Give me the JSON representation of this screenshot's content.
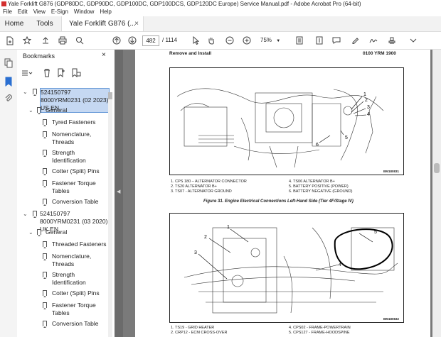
{
  "window": {
    "title": "Yale Forklift G876 (GDP80DC, GDP90DC, GDP100DC, GDP100DCS, GDP120DC Europe) Service Manual.pdf - Adobe Acrobat Pro (64-bit)"
  },
  "menu": [
    "File",
    "Edit",
    "View",
    "E-Sign",
    "Window",
    "Help"
  ],
  "tabs": {
    "home": "Home",
    "tools": "Tools",
    "doc": "Yale Forklift G876 (...",
    "close": "×"
  },
  "toolbar": {
    "page": "482",
    "total": "/ 1114",
    "zoom": "75%"
  },
  "panel": {
    "title": "Bookmarks",
    "close": "×",
    "items": [
      {
        "label": "524150797 8000YRM0231 (02 2023) US EN"
      },
      {
        "label": "General"
      },
      {
        "label": "Tyred Fasteners"
      },
      {
        "label": "Nomenclature, Threads"
      },
      {
        "label": "Strength Identification"
      },
      {
        "label": "Cotter (Split) Pins"
      },
      {
        "label": "Fastener Torque Tables"
      },
      {
        "label": "Conversion Table"
      },
      {
        "label": "524150797 8000YRM0231 (03 2020) UK EN"
      },
      {
        "label": "General"
      },
      {
        "label": "Threaded Fasteners"
      },
      {
        "label": "Nomenclature, Threads"
      },
      {
        "label": "Strength Identification"
      },
      {
        "label": "Cotter (Split) Pins"
      },
      {
        "label": "Fastener Torque Tables"
      },
      {
        "label": "Conversion Table"
      }
    ]
  },
  "page": {
    "header_left": "Remove and Install",
    "header_right": "0100 YRM 1900",
    "fig1": {
      "tag": "BM180831",
      "callouts": [
        "1",
        "2",
        "3",
        "4",
        "5",
        "6"
      ],
      "legend": [
        "1.   CPS 180 – ALTERNATOR CONNECTOR",
        "2.   TS20 ALTERNATOR B+",
        "3.   TS07 - ALTERNATOR GROUND",
        "4.   TS06 ALTERNATOR B+",
        "5.   BATTERY POSITIVE (POWER)",
        "6.   BATTERY NEGATIVE (GROUND)"
      ],
      "caption": "Figure 31. Engine Electrical Connections Left-Hand Side (Tier 4F/Stage IV)"
    },
    "fig2": {
      "tag": "BM180832",
      "callouts": [
        "1",
        "2",
        "3",
        "4",
        "5"
      ],
      "legend": [
        "1.   TS19 - GRID HEATER",
        "2.   CRP12 - ECM CROSS-OVER",
        "4.   CPS02 - FRAME-POWERTRAIN",
        "5.   CPS127 - FRAME-HOODSPINE"
      ]
    }
  }
}
